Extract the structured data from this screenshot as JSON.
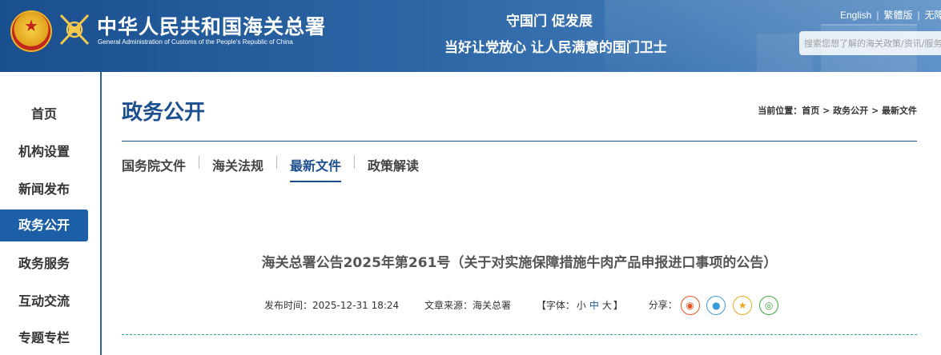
{
  "header": {
    "site_name_cn": "中华人民共和国海关总署",
    "site_name_en": "General Administration of Customs of the People's Republic of China",
    "slogan_line1": "守国门  促发展",
    "slogan_line2": "当好让党放心  让人民满意的国门卫士",
    "languages": [
      "English",
      "繁體版",
      "无障"
    ],
    "search_placeholder": "搜索您想了解的海关政策/资讯/服务"
  },
  "sidebar": {
    "items": [
      {
        "label": "首页"
      },
      {
        "label": "机构设置"
      },
      {
        "label": "新闻发布"
      },
      {
        "label": "政务公开",
        "active": true
      },
      {
        "label": "政务服务"
      },
      {
        "label": "互动交流"
      },
      {
        "label": "专题专栏"
      }
    ]
  },
  "main": {
    "title": "政务公开",
    "breadcrumb": {
      "prefix": "当前位置：",
      "items": [
        "首页",
        "政务公开",
        "最新文件"
      ]
    },
    "tabs": [
      {
        "label": "国务院文件"
      },
      {
        "label": "海关法规"
      },
      {
        "label": "最新文件",
        "active": true
      },
      {
        "label": "政策解读"
      }
    ]
  },
  "article": {
    "title": "海关总署公告2025年第261号（关于对实施保障措施牛肉产品申报进口事项的公告）",
    "publish_label": "发布时间：",
    "publish_time": "2025-12-31 18:24",
    "source_label": "文章来源：",
    "source": "海关总署",
    "font_label": "【字体：",
    "font_small": "小",
    "font_medium": "中",
    "font_large": "大",
    "font_close": "】",
    "share_label": "分享：",
    "share_icons": [
      {
        "name": "weibo-icon",
        "color": "#e8541e"
      },
      {
        "name": "qq-icon",
        "color": "#3a9bd9"
      },
      {
        "name": "qzone-icon",
        "color": "#f0a81c"
      },
      {
        "name": "wechat-icon",
        "color": "#3aa83a"
      }
    ]
  }
}
